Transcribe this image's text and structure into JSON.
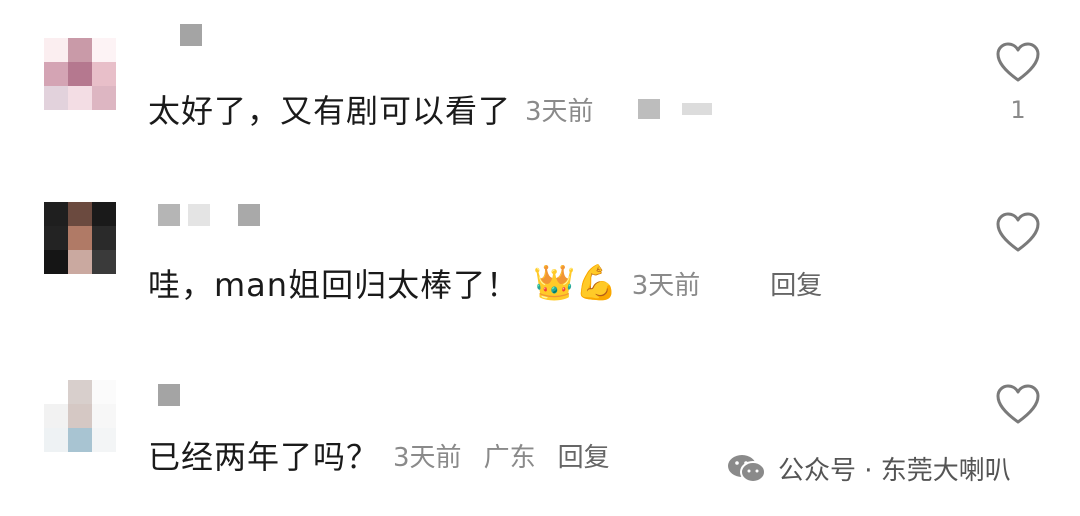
{
  "comments": [
    {
      "text": "太好了，又有剧可以看了",
      "time": "3天前",
      "reply": "",
      "location": "",
      "like_count": "1"
    },
    {
      "text": "哇，man姐回归太棒了！",
      "emojis": "👑💪",
      "time": "3天前",
      "reply": "回复",
      "location": "",
      "like_count": ""
    },
    {
      "text": "已经两年了吗？",
      "time": "3天前",
      "location": "广东",
      "reply": "回复",
      "like_count": ""
    }
  ],
  "icons": {
    "like": "heart-outline-icon",
    "watermark": "wechat-icon"
  },
  "watermark": {
    "text": "公众号 · 东莞大喇叭"
  },
  "colors": {
    "text": "#1a1a1a",
    "meta": "#8a8a8a",
    "heart": "#7a7a7a"
  }
}
